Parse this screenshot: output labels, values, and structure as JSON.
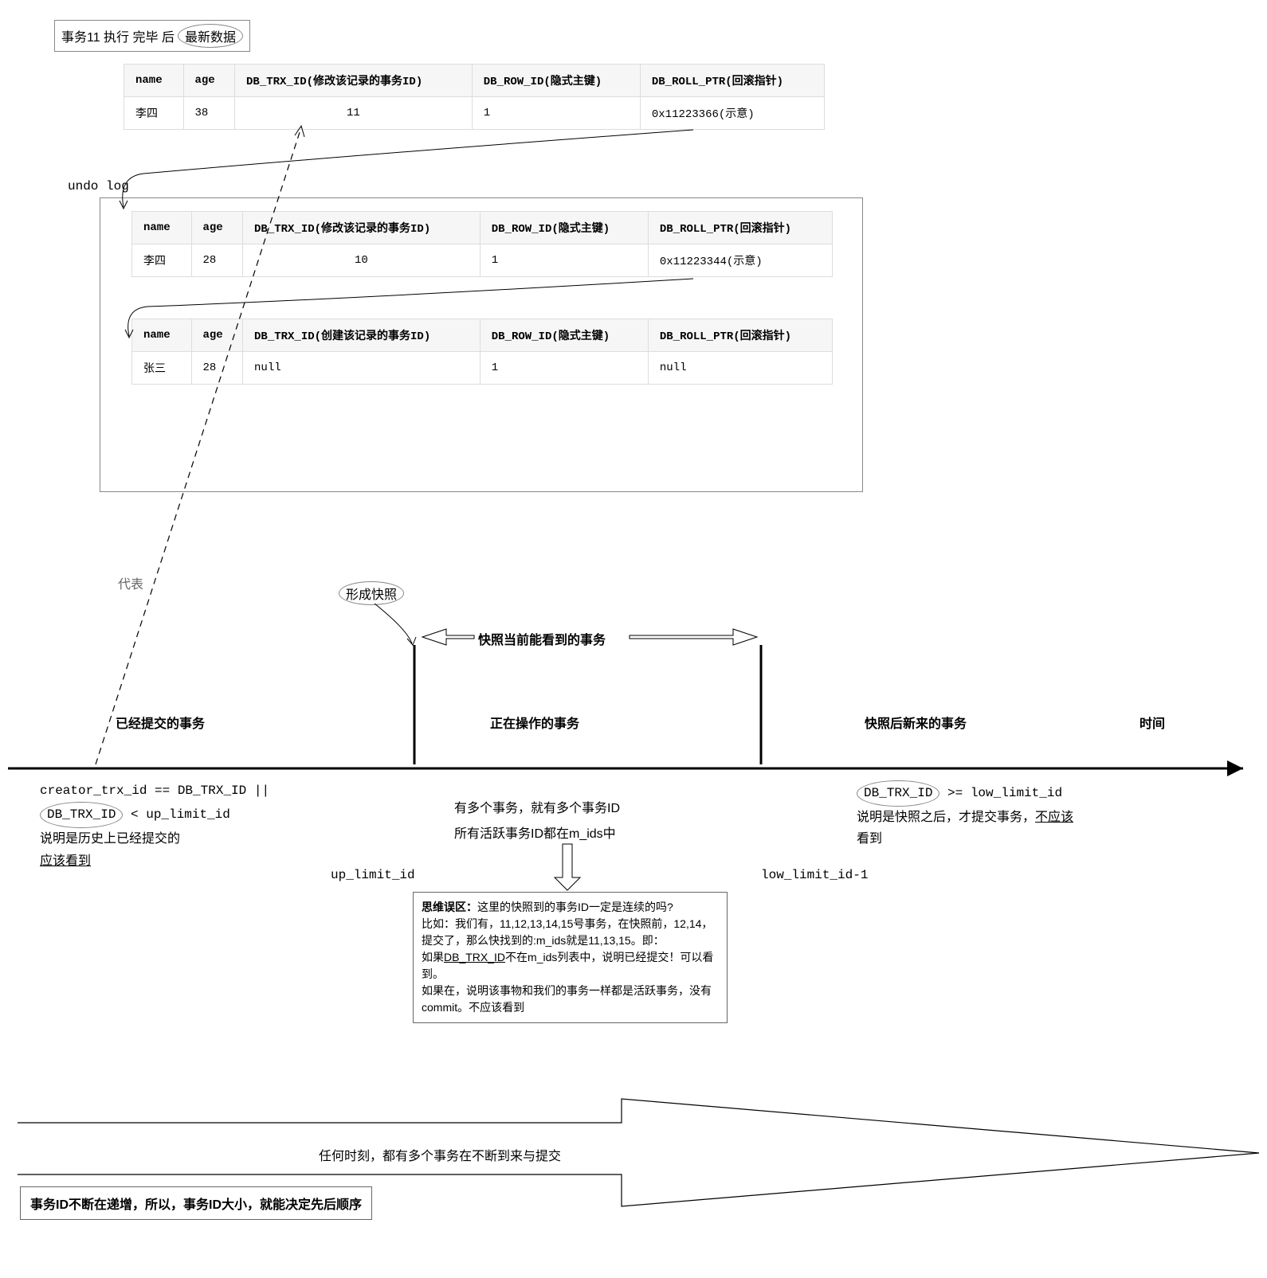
{
  "title": {
    "pre": "事务11 执行 完毕 后",
    "badge": "最新数据"
  },
  "table_current": {
    "headers": [
      "name",
      "age",
      "DB_TRX_ID(修改该记录的事务ID)",
      "DB_ROW_ID(隐式主键)",
      "DB_ROLL_PTR(回滚指针)"
    ],
    "row": [
      "李四",
      "38",
      "11",
      "1",
      "0x11223366(示意)"
    ]
  },
  "undo_label": "undo log",
  "table_undo1": {
    "headers": [
      "name",
      "age",
      "DB_TRX_ID(修改该记录的事务ID)",
      "DB_ROW_ID(隐式主键)",
      "DB_ROLL_PTR(回滚指针)"
    ],
    "row": [
      "李四",
      "28",
      "10",
      "1",
      "0x11223344(示意)"
    ]
  },
  "table_undo2": {
    "headers": [
      "name",
      "age",
      "DB_TRX_ID(创建该记录的事务ID)",
      "DB_ROW_ID(隐式主键)",
      "DB_ROLL_PTR(回滚指针)"
    ],
    "row": [
      "张三",
      "28",
      "null",
      "1",
      "null"
    ]
  },
  "represent_label": "代表",
  "snapshot_badge": "形成快照",
  "snapshot_vis_header": "快照当前能看到的事务",
  "region_left": "已经提交的事务",
  "region_mid": "正在操作的事务",
  "region_right": "快照后新来的事务",
  "time_label": "时间",
  "left_rules": {
    "l1": "creator_trx_id == DB_TRX_ID ||",
    "l2_a": "DB_TRX_ID",
    "l2_b": " < up_limit_id",
    "l3": "说明是历史上已经提交的",
    "l4": "应该看到"
  },
  "mid_rules": {
    "l1": "有多个事务，就有多个事务ID",
    "l2": "所有活跃事务ID都在m_ids中"
  },
  "right_rules": {
    "l1_a": "DB_TRX_ID",
    "l1_b": " >= low_limit_id",
    "l2": "说明是快照之后，才提交事务，",
    "l2u": "不应该",
    "l3": "看到"
  },
  "up_limit_label": "up_limit_id",
  "low_limit_label": "low_limit_id-1",
  "note": {
    "t": "思维误区：",
    "p1": "这里的快照到的事务ID一定是连续的吗?",
    "p2": "比如：我们有，11,12,13,14,15号事务，在快照前，12,14，提交了，那么快找到的:m_ids就是11,13,15。即：",
    "p3a": "如果",
    "p3k": "DB_TRX_ID",
    "p3b": "不在m_ids列表中，说明已经提交！可以看到。",
    "p4": "如果在，说明该事物和我们的事务一样都是活跃事务，没有commit。不应该看到"
  },
  "banner": "任何时刻，都有多个事务在不断到来与提交",
  "bottom_box": "事务ID不断在递增，所以，事务ID大小，就能决定先后顺序"
}
